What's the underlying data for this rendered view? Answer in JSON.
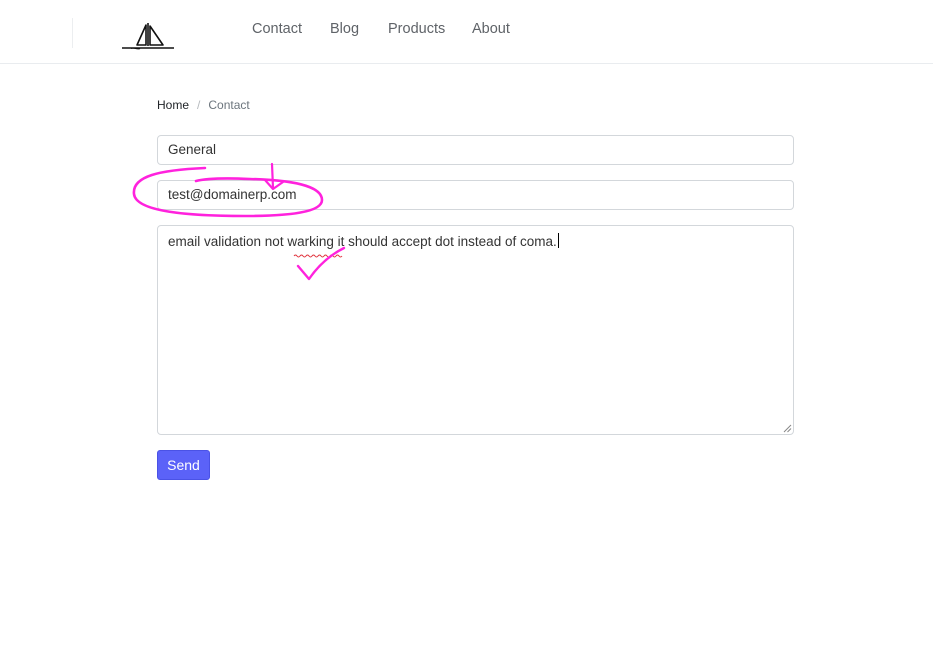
{
  "nav": {
    "logo_icon": "sailboat-icon",
    "links": [
      {
        "label": "Contact"
      },
      {
        "label": "Blog"
      },
      {
        "label": "Products"
      },
      {
        "label": "About"
      }
    ]
  },
  "breadcrumb": {
    "home": "Home",
    "separator": "/",
    "current": "Contact"
  },
  "form": {
    "subject_value": "General",
    "email_value": "test@domainerp.com",
    "message_value": "email validation not warking it should accept dot instead of coma.",
    "misspelled_word": "warking",
    "send_label": "Send"
  },
  "colors": {
    "accent": "#5b62f8",
    "annotation": "#ff22dd"
  }
}
